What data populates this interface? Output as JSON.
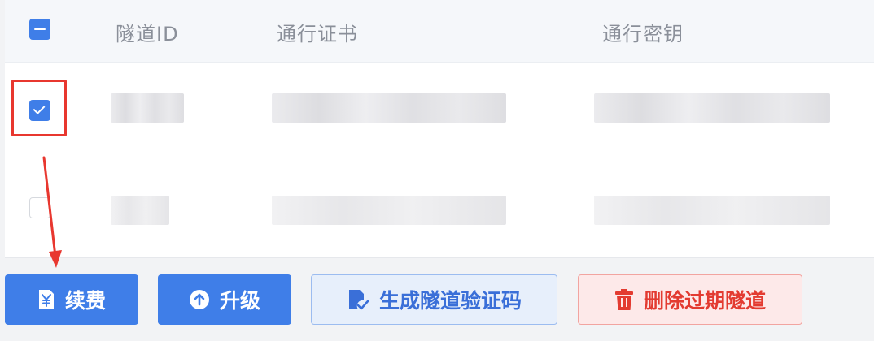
{
  "table": {
    "columns": [
      "隧道ID",
      "通行证书",
      "通行密钥"
    ],
    "rows": [
      {
        "checked": true
      },
      {
        "checked": false
      }
    ]
  },
  "actions": {
    "renew_label": "续费",
    "upgrade_label": "升级",
    "code_label": "生成隧道验证码",
    "delete_label": "删除过期隧道"
  },
  "icons": {
    "renew": "yen-document-icon",
    "upgrade": "upload-arrow-icon",
    "code": "document-check-icon",
    "delete": "trash-icon"
  },
  "colors": {
    "primary": "#3f7ee8",
    "danger": "#e33b31",
    "annotation": "#e8372f"
  }
}
